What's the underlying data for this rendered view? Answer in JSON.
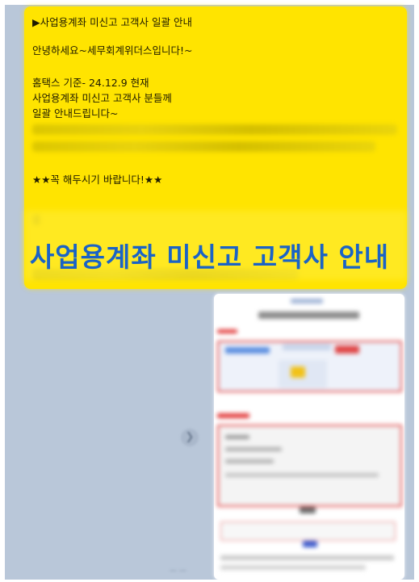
{
  "message": {
    "lines": [
      "▶사업용계좌 미신고 고객사 일괄 안내",
      "안녕하세요~세무회계위더스입니다!~",
      "홈택스 기준- 24.12.9 현재",
      "사업용계좌 미신고 고객사 분들께",
      "일괄 안내드립니다~",
      "★★꼭 해두시기 바랍니다!★★"
    ],
    "overlay_title": "사업용계좌 미신고 고객사 안내"
  },
  "colors": {
    "bubble": "#ffe400",
    "overlay_text": "#1a63c6",
    "chat_background": "#b9c7d9"
  },
  "icons": {
    "forward": "share-forward-icon"
  }
}
